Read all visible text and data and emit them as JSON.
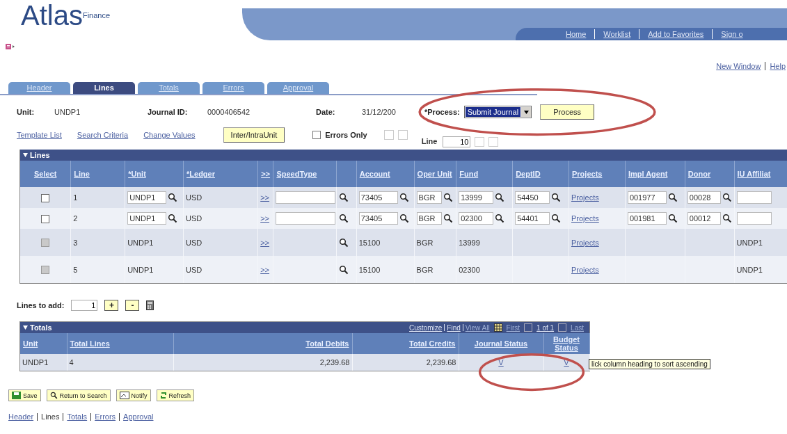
{
  "logo": {
    "name": "Atlas",
    "sub": "Finance"
  },
  "top_nav": [
    "Home",
    "Worklist",
    "Add to Favorites",
    "Sign o"
  ],
  "util_links": [
    "New Window",
    "Help"
  ],
  "tabs": [
    {
      "label": "Header",
      "selected": false
    },
    {
      "label": "Lines",
      "selected": true
    },
    {
      "label": "Totals",
      "selected": false
    },
    {
      "label": "Errors",
      "selected": false
    },
    {
      "label": "Approval",
      "selected": false
    }
  ],
  "header": {
    "unit_label": "Unit:",
    "unit": "UNDP1",
    "journal_label": "Journal ID:",
    "journal_id": "0000406542",
    "date_label": "Date:",
    "date": "31/12/200",
    "process_label": "*Process:",
    "process_value": "Submit Journal",
    "process_button": "Process"
  },
  "actions": {
    "links": [
      "Template List",
      "Search Criteria",
      "Change Values"
    ],
    "inter_button": "Inter/IntraUnit",
    "errors_only": {
      "label": "Errors Only",
      "checked": false
    },
    "line_label": "Line",
    "line_value": "10"
  },
  "lines": {
    "title": "Lines",
    "columns": [
      "Select",
      "Line",
      "*Unit",
      "*Ledger",
      ">>",
      "SpeedType",
      "Account",
      "Oper Unit",
      "Fund",
      "DeptID",
      "Projects",
      "Impl Agent",
      "Donor",
      "IU Affiliat"
    ],
    "rows": [
      {
        "kind": "editable",
        "selected": false,
        "line": "1",
        "unit": "UNDP1",
        "ledger": "USD",
        "link": ">>",
        "account": "73405",
        "oper_unit": "BGR",
        "fund": "13999",
        "deptid": "54450",
        "projects": "Projects",
        "impl_agent": "001977",
        "donor": "00028"
      },
      {
        "kind": "editable",
        "selected": false,
        "line": "2",
        "unit": "UNDP1",
        "ledger": "USD",
        "link": ">>",
        "account": "73405",
        "oper_unit": "BGR",
        "fund": "02300",
        "deptid": "54401",
        "projects": "Projects",
        "impl_agent": "001981",
        "donor": "00012"
      },
      {
        "kind": "readonly",
        "selected": false,
        "line": "3",
        "unit": "UNDP1",
        "ledger": "USD",
        "link": ">>",
        "account": "15100",
        "oper_unit": "BGR",
        "fund": "13999",
        "projects": "Projects",
        "affiliate": "UNDP1"
      },
      {
        "kind": "readonly",
        "selected": false,
        "line": "5",
        "unit": "UNDP1",
        "ledger": "USD",
        "link": ">>",
        "account": "15100",
        "oper_unit": "BGR",
        "fund": "02300",
        "projects": "Projects",
        "affiliate": "UNDP1"
      }
    ]
  },
  "lines_to_add": {
    "label": "Lines to add:",
    "value": "1",
    "add": "+",
    "remove": "-"
  },
  "totals": {
    "title": "Totals",
    "nav_links": [
      "Customize",
      "Find",
      "View All"
    ],
    "first": "First",
    "range": "1 of 1",
    "last": "Last",
    "columns": [
      "Unit",
      "Total Lines",
      "Total Debits",
      "Total Credits",
      "Journal Status",
      "Budget Status"
    ],
    "rows": [
      [
        "UNDP1",
        "4",
        "2,239.68",
        "2,239.68",
        "V",
        "V"
      ]
    ],
    "tooltip": "lick column heading to sort ascending"
  },
  "buttons": [
    "Save",
    "Return to Search",
    "Notify",
    "Refresh"
  ],
  "bottom_links": [
    {
      "label": "Header",
      "link": true
    },
    {
      "label": "Lines",
      "link": false
    },
    {
      "label": "Totals",
      "link": true
    },
    {
      "label": "Errors",
      "link": true
    },
    {
      "label": "Approval",
      "link": true
    }
  ]
}
